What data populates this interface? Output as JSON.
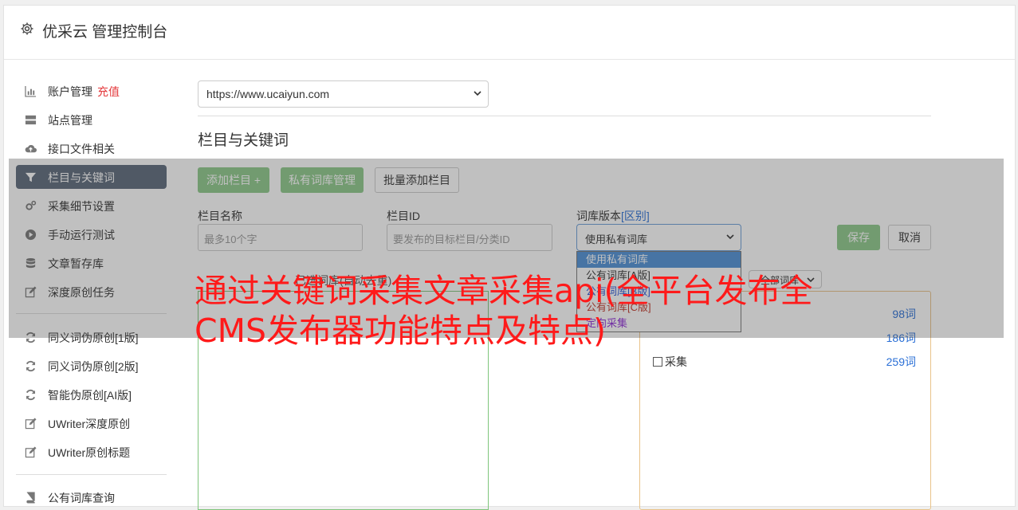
{
  "header": {
    "title": "优采云 管理控制台",
    "icon": "gear-icon"
  },
  "sidebar": {
    "items": [
      {
        "label": "账户管理",
        "extra": "充值",
        "icon": "bar-chart-icon"
      },
      {
        "label": "站点管理",
        "icon": "server-icon"
      },
      {
        "label": "接口文件相关",
        "icon": "cloud-upload-icon"
      },
      {
        "label": "栏目与关键词",
        "icon": "filter-icon",
        "active": true
      },
      {
        "label": "采集细节设置",
        "icon": "cogs-icon"
      },
      {
        "label": "手动运行测试",
        "icon": "play-circle-icon"
      },
      {
        "label": "文章暂存库",
        "icon": "database-icon"
      },
      {
        "label": "深度原创任务",
        "icon": "edit-icon"
      },
      {
        "label": "同义词伪原创[1版]",
        "icon": "refresh-icon"
      },
      {
        "label": "同义词伪原创[2版]",
        "icon": "refresh-icon"
      },
      {
        "label": "智能伪原创[AI版]",
        "icon": "refresh-icon"
      },
      {
        "label": "UWriter深度原创",
        "icon": "edit-icon"
      },
      {
        "label": "UWriter原创标题",
        "icon": "edit-icon"
      },
      {
        "label": "公有词库查询",
        "icon": "book-icon"
      }
    ]
  },
  "main": {
    "site_select": "https://www.ucaiyun.com",
    "section_title": "栏目与关键词",
    "buttons": {
      "add_column": "添加栏目 +",
      "private_lib": "私有词库管理",
      "batch_add": "批量添加栏目",
      "save": "保存",
      "cancel": "取消"
    },
    "fields": {
      "name_label": "栏目名称",
      "name_placeholder": "最多10个字",
      "id_label": "栏目ID",
      "id_placeholder": "要发布的目标栏目/分类ID",
      "lib_label": "词库版本",
      "lib_diff": "[区别]",
      "lib_value": "使用私有词库"
    },
    "dropdown_options": [
      {
        "label": "使用私有词库",
        "color": "#ffffff",
        "selected": true
      },
      {
        "label": "公有词库[A版]",
        "color": "#333333"
      },
      {
        "label": "公有词库[B版]",
        "color": "#2a56d6"
      },
      {
        "label": "公有词库[C版]",
        "color": "#c0392b"
      },
      {
        "label": "定向采集",
        "color": "#8e2bd6"
      }
    ],
    "selected_words_label": "已选词库(自动去重)",
    "all_lib_select": "全部词库",
    "keyword_rows": [
      {
        "name": "",
        "count": "98词"
      },
      {
        "name": "",
        "count": "186词"
      },
      {
        "name": "采集",
        "count": "259词"
      }
    ]
  },
  "overlay_caption": "通过关键词采集文章采集api(全平台发布全CMS发布器功能特点及特点)",
  "colors": {
    "green": "#8cc98a",
    "active_bg": "#5b6779",
    "link_blue": "#2a6fd6",
    "caption_red": "#ff1a1a"
  }
}
